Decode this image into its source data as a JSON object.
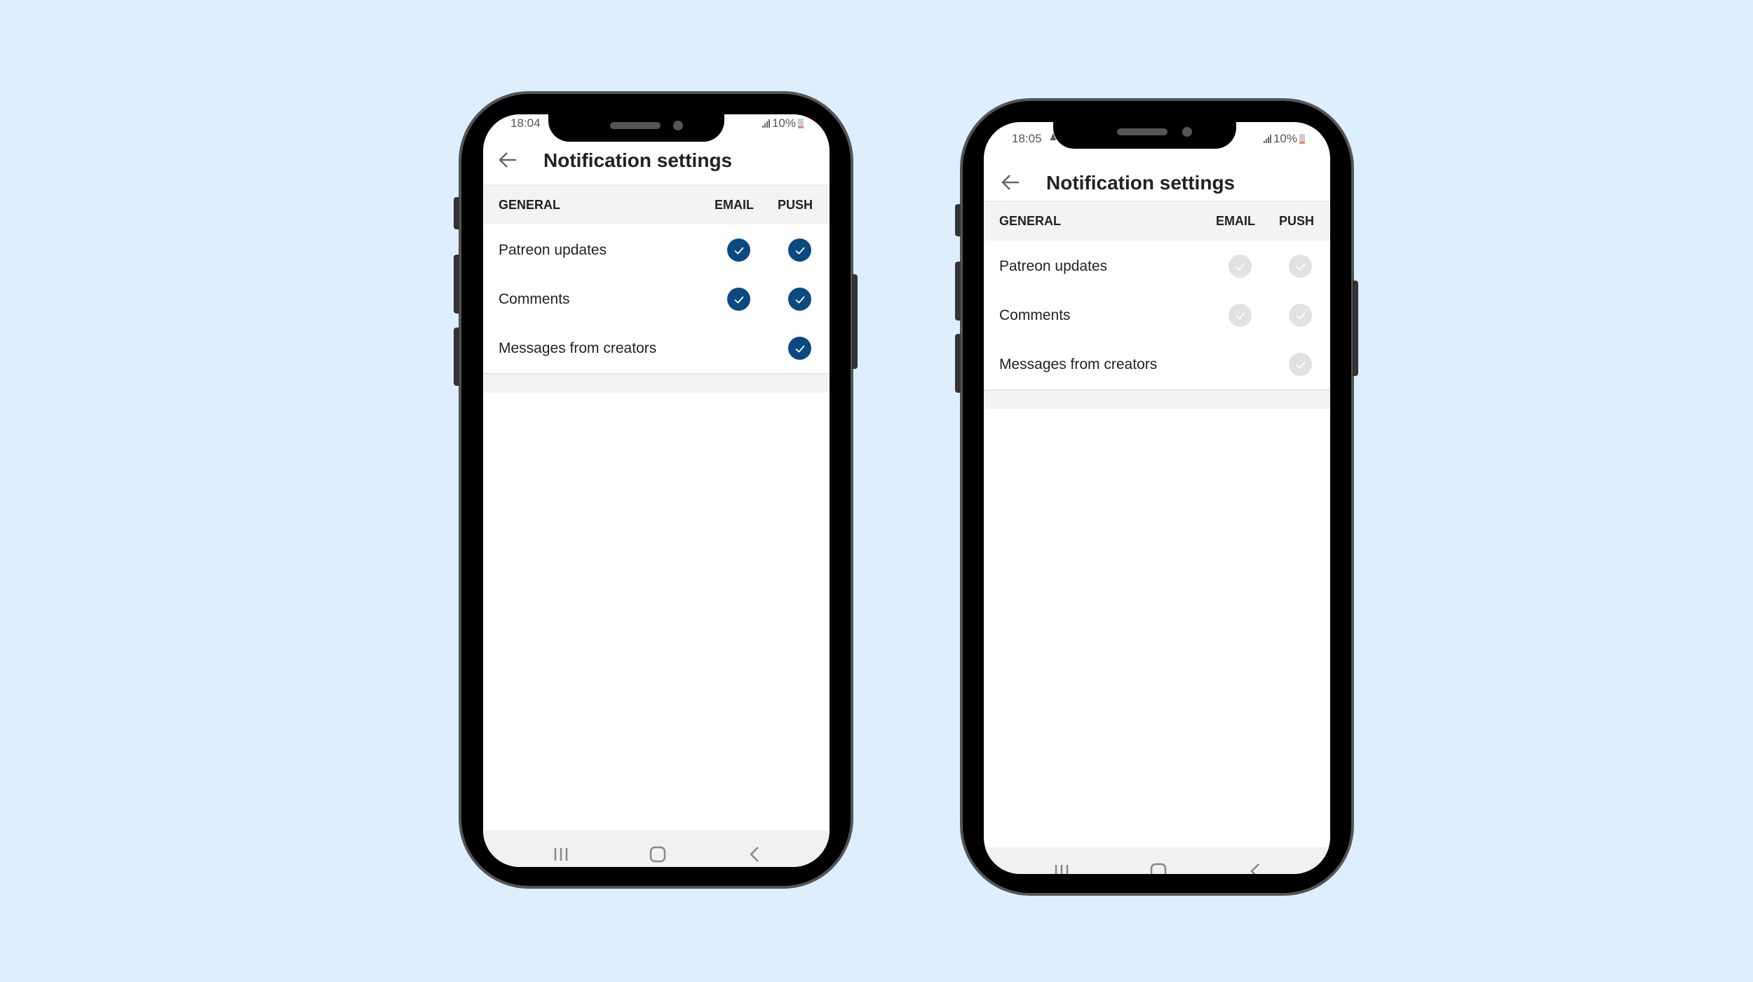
{
  "background_color": "#ddeeff",
  "phones": [
    {
      "status": {
        "time": "18:04",
        "battery": "10%"
      },
      "header": {
        "title": "Notification settings",
        "back_icon": "arrow-left-icon"
      },
      "section": {
        "title": "GENERAL",
        "col_email": "EMAIL",
        "col_push": "PUSH"
      },
      "rows": [
        {
          "label": "Patreon updates",
          "email": true,
          "push": true
        },
        {
          "label": "Comments",
          "email": true,
          "push": true
        },
        {
          "label": "Messages from creators",
          "email": null,
          "push": true
        }
      ],
      "check_style": "enabled",
      "check_color": "#0b4a80",
      "navbar": [
        "recents-icon",
        "home-icon",
        "back-icon"
      ]
    },
    {
      "status": {
        "time": "18:05",
        "battery": "10%"
      },
      "header": {
        "title": "Notification settings",
        "back_icon": "arrow-left-icon"
      },
      "section": {
        "title": "GENERAL",
        "col_email": "EMAIL",
        "col_push": "PUSH"
      },
      "rows": [
        {
          "label": "Patreon updates",
          "email": true,
          "push": true
        },
        {
          "label": "Comments",
          "email": true,
          "push": true
        },
        {
          "label": "Messages from creators",
          "email": null,
          "push": true
        }
      ],
      "check_style": "disabled",
      "check_color": "#e3e2df",
      "navbar": [
        "recents-icon",
        "home-icon",
        "back-icon"
      ]
    }
  ]
}
